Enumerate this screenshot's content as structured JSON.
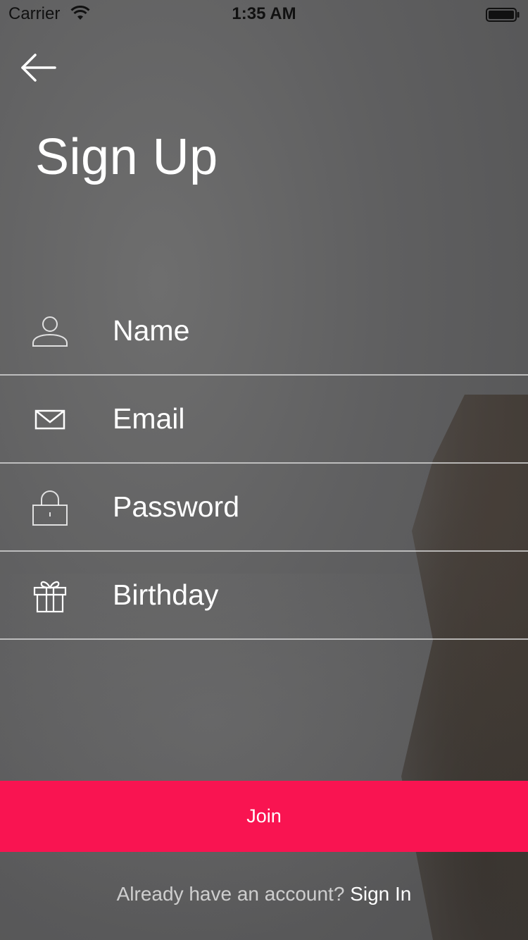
{
  "status_bar": {
    "carrier": "Carrier",
    "time": "1:35 AM"
  },
  "header": {
    "title": "Sign Up"
  },
  "form": {
    "fields": [
      {
        "placeholder": "Name",
        "icon": "person-icon"
      },
      {
        "placeholder": "Email",
        "icon": "envelope-icon"
      },
      {
        "placeholder": "Password",
        "icon": "lock-icon"
      },
      {
        "placeholder": "Birthday",
        "icon": "gift-icon"
      }
    ]
  },
  "actions": {
    "join_label": "Join"
  },
  "footer": {
    "prompt": "Already have an account?",
    "signin_label": "Sign In"
  },
  "colors": {
    "accent": "#f91451",
    "text": "#ffffff"
  }
}
